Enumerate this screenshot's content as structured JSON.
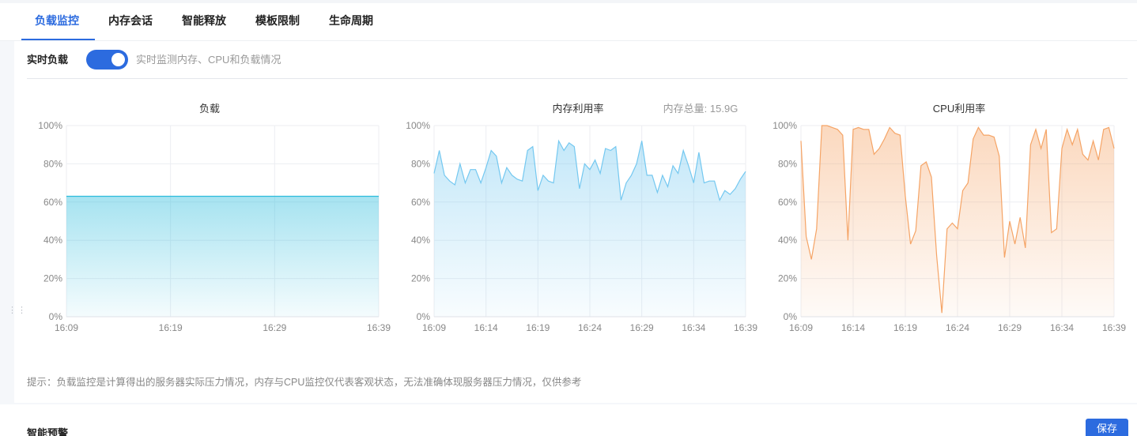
{
  "tabs": [
    {
      "label": "负载监控",
      "active": true
    },
    {
      "label": "内存会话",
      "active": false
    },
    {
      "label": "智能释放",
      "active": false
    },
    {
      "label": "模板限制",
      "active": false
    },
    {
      "label": "生命周期",
      "active": false
    }
  ],
  "realtime": {
    "label": "实时负载",
    "enabled": true,
    "description": "实时监测内存、CPU和负载情况"
  },
  "hint": "提示：负载监控是计算得出的服务器实际压力情况，内存与CPU监控仅代表客观状态，无法准确体现服务器压力情况，仅供参考",
  "alert": {
    "title": "智能预警",
    "save_label": "保存"
  },
  "colors": {
    "accent": "#2c6bdf",
    "load": "#2bbcdc",
    "memory": "#74c8f0",
    "cpu": "#f5a466"
  },
  "chart_data": [
    {
      "type": "area",
      "title": "负载",
      "x_ticks": [
        "16:09",
        "16:19",
        "16:29",
        "16:39"
      ],
      "y_ticks": [
        "100%",
        "80%",
        "60%",
        "40%",
        "20%",
        "0%"
      ],
      "ylim": [
        0,
        100
      ],
      "series": [
        {
          "values": [
            63,
            63,
            63,
            63,
            63,
            63,
            63,
            63,
            63,
            63,
            63,
            63,
            63,
            63,
            63,
            63,
            63,
            63,
            63,
            63,
            63,
            63,
            63,
            63,
            63,
            63,
            63,
            63,
            63,
            63,
            63
          ]
        }
      ]
    },
    {
      "type": "area",
      "title": "内存利用率",
      "subtitle": "内存总量: 15.9G",
      "x_ticks": [
        "16:09",
        "16:14",
        "16:19",
        "16:24",
        "16:29",
        "16:34",
        "16:39"
      ],
      "y_ticks": [
        "100%",
        "80%",
        "60%",
        "40%",
        "20%",
        "0%"
      ],
      "ylim": [
        0,
        100
      ],
      "series": [
        {
          "values": [
            75,
            87,
            74,
            71,
            69,
            80,
            70,
            77,
            77,
            70,
            78,
            87,
            84,
            70,
            78,
            74,
            72,
            71,
            87,
            89,
            66,
            74,
            71,
            70,
            92,
            87,
            91,
            89,
            67,
            80,
            77,
            82,
            75,
            88,
            87,
            89,
            61,
            70,
            74,
            80,
            92,
            74,
            74,
            65,
            74,
            68,
            79,
            75,
            87,
            79,
            70,
            86,
            70,
            71,
            71,
            61,
            66,
            64,
            67,
            72,
            76
          ]
        }
      ]
    },
    {
      "type": "area",
      "title": "CPU利用率",
      "x_ticks": [
        "16:09",
        "16:14",
        "16:19",
        "16:24",
        "16:29",
        "16:34",
        "16:39"
      ],
      "y_ticks": [
        "100%",
        "80%",
        "60%",
        "40%",
        "20%",
        "0%"
      ],
      "ylim": [
        0,
        100
      ],
      "series": [
        {
          "values": [
            92,
            42,
            30,
            46,
            100,
            100,
            99,
            98,
            95,
            40,
            98,
            99,
            98,
            98,
            85,
            88,
            93,
            99,
            96,
            95,
            63,
            38,
            45,
            79,
            81,
            73,
            32,
            2,
            46,
            49,
            46,
            66,
            70,
            93,
            99,
            95,
            95,
            94,
            84,
            31,
            50,
            38,
            52,
            36,
            90,
            98,
            88,
            98,
            44,
            46,
            88,
            98,
            90,
            98,
            85,
            82,
            92,
            82,
            98,
            99,
            88
          ]
        }
      ]
    }
  ]
}
